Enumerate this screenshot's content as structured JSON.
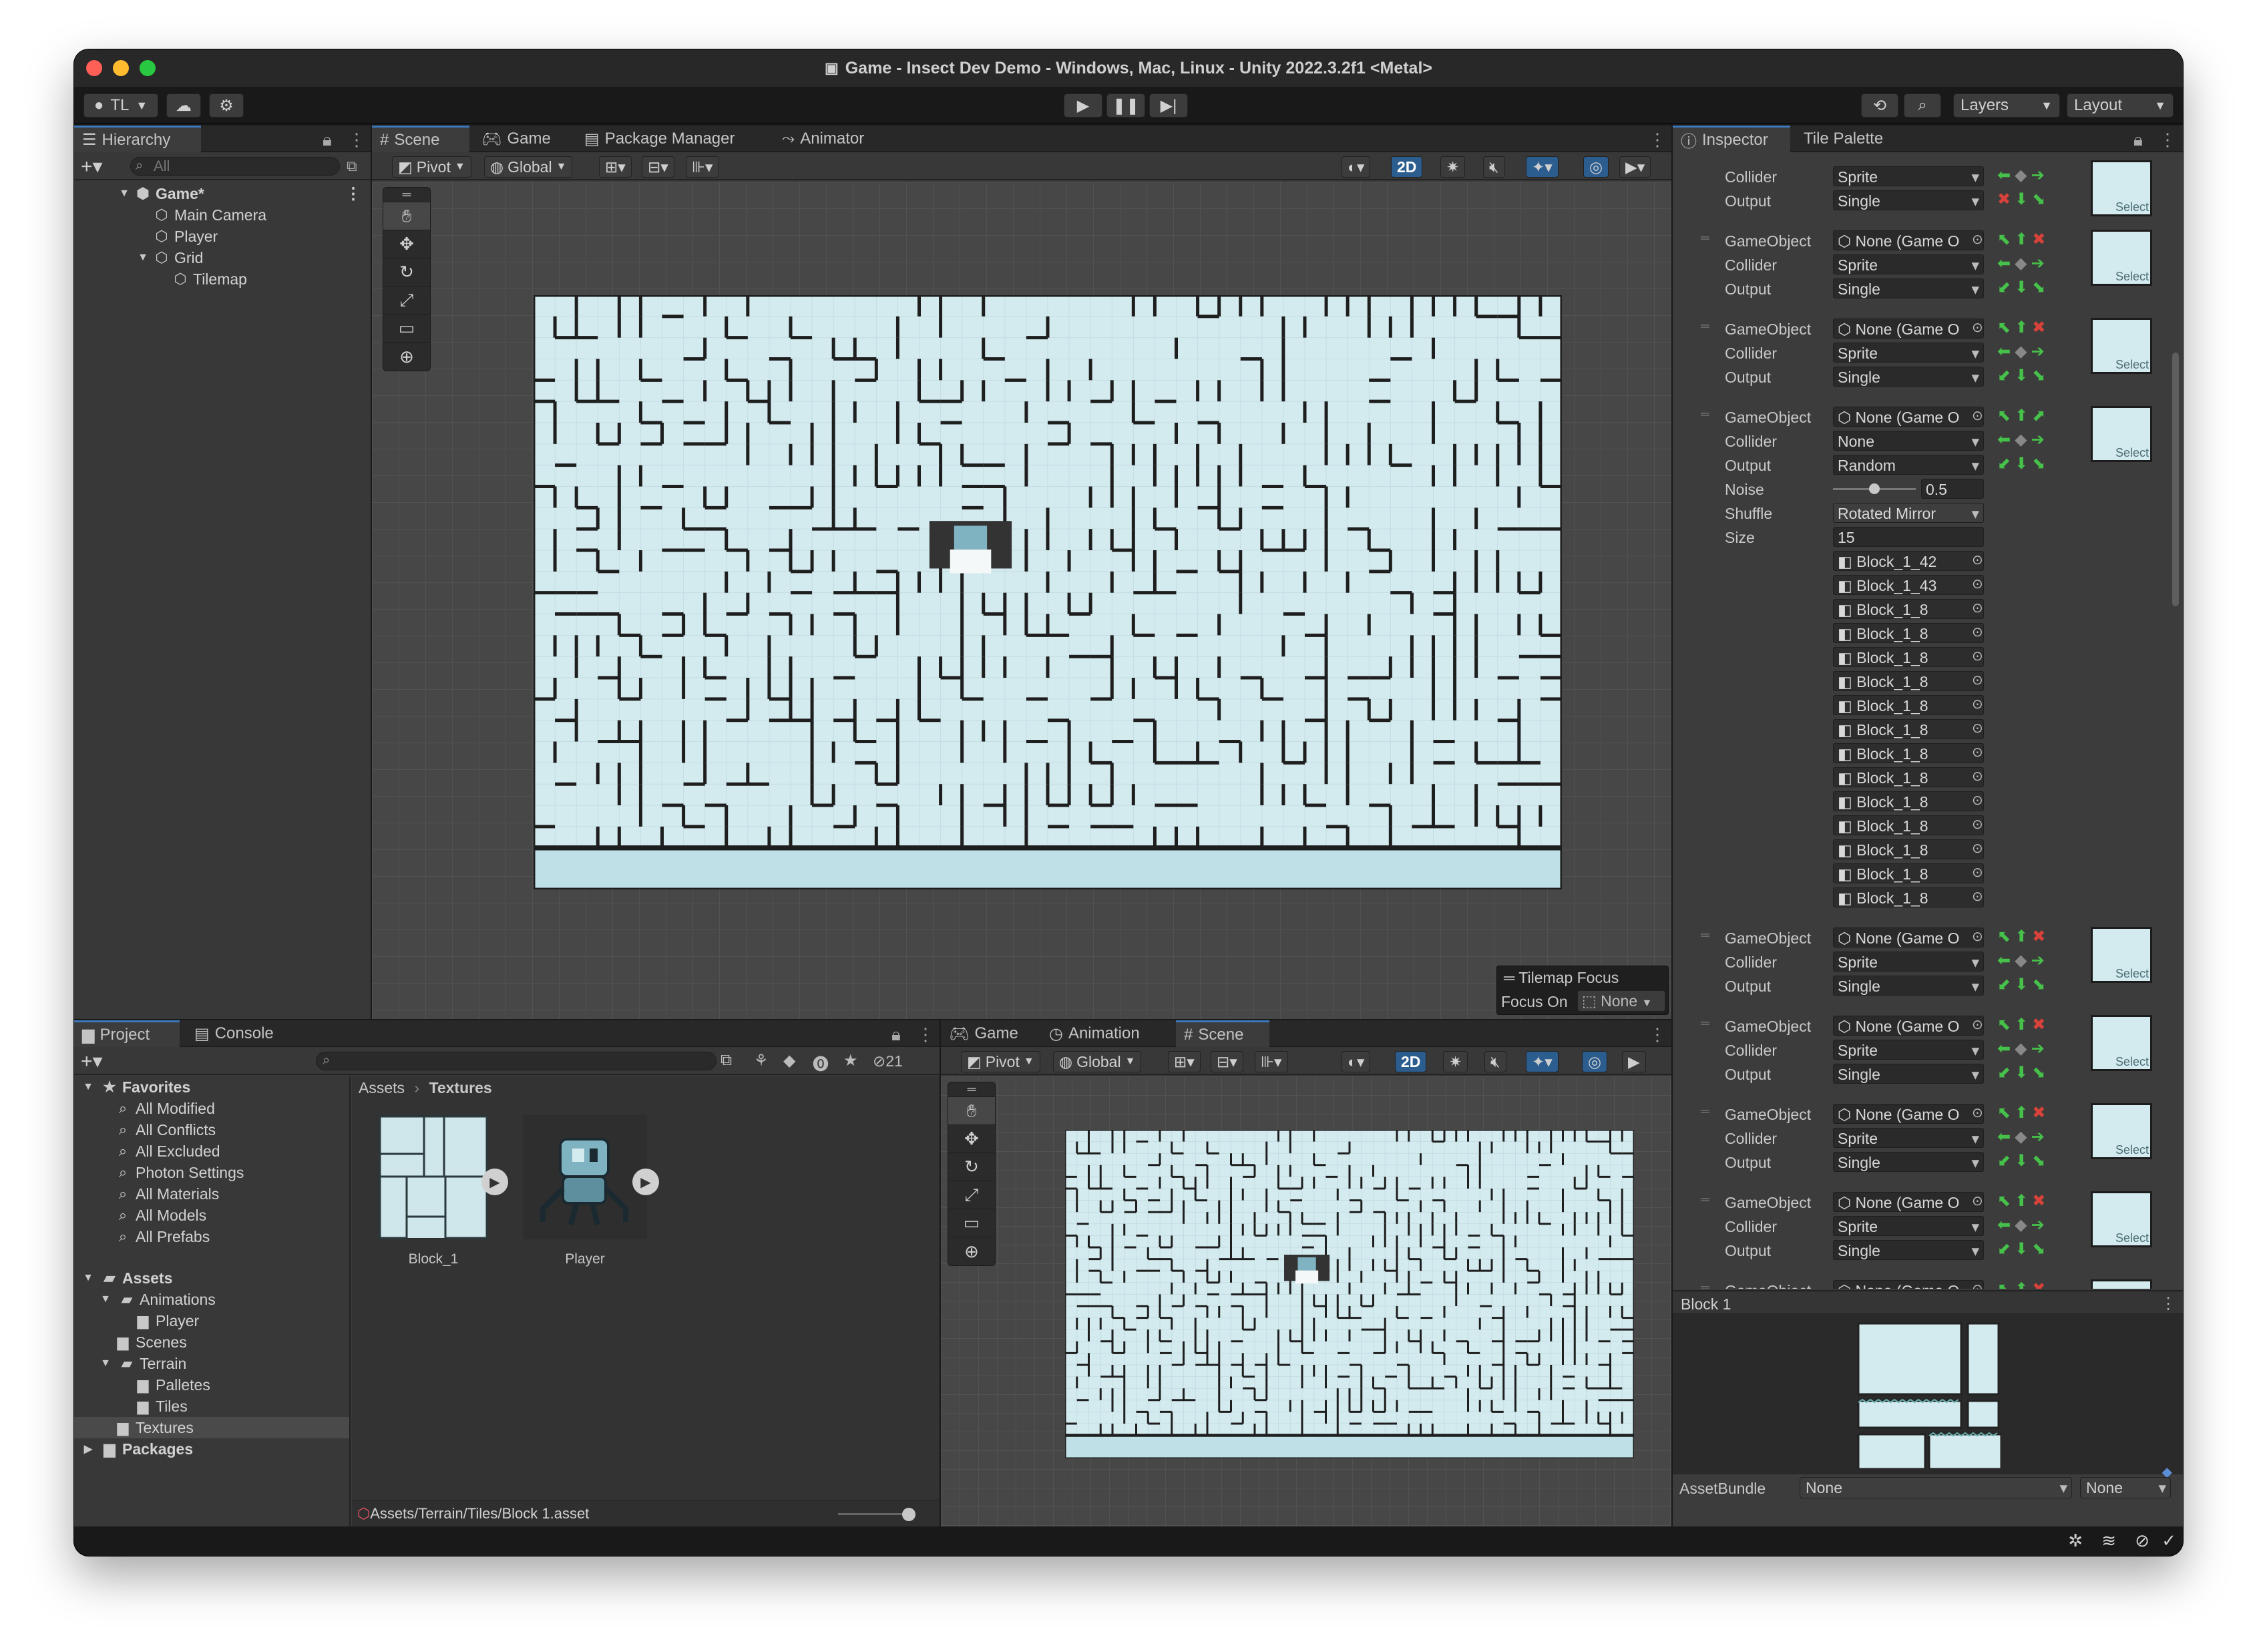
{
  "window": {
    "title": "Game - Insect Dev Demo - Windows, Mac, Linux - Unity 2022.3.2f1 <Metal>"
  },
  "colors": {
    "accent": "#3a79bb",
    "maze_bg": "#d3ebef",
    "wall": "#1e1e1e",
    "panel": "#383838",
    "green_arrow": "#46c24a",
    "red_x": "#d9423a"
  },
  "toolbar": {
    "account": "TL",
    "layers": "Layers",
    "layout": "Layout"
  },
  "hierarchy": {
    "tab": "Hierarchy",
    "search_placeholder": "All",
    "items": [
      {
        "label": "Game*",
        "icon": "unity-scene-icon"
      },
      {
        "label": "Main Camera",
        "icon": "gameobject-cube-icon"
      },
      {
        "label": "Player",
        "icon": "gameobject-cube-icon"
      },
      {
        "label": "Grid",
        "icon": "gameobject-cube-icon"
      },
      {
        "label": "Tilemap",
        "icon": "gameobject-cube-icon"
      }
    ]
  },
  "scene_view": {
    "tabs": [
      {
        "label": "Scene",
        "icon": "hash-icon"
      },
      {
        "label": "Game",
        "icon": "gamepad-icon"
      },
      {
        "label": "Package Manager",
        "icon": "package-icon"
      },
      {
        "label": "Animator",
        "icon": "animator-icon"
      }
    ],
    "pivot": "Pivot",
    "global": "Global",
    "mode_2d": "2D",
    "tilemap_focus_title": "Tilemap Focus",
    "focus_on_label": "Focus On",
    "focus_on_value": "None"
  },
  "project": {
    "tabs": [
      {
        "label": "Project",
        "icon": "folder-icon"
      },
      {
        "label": "Console",
        "icon": "console-icon"
      }
    ],
    "hidden_count": "21",
    "favorites_label": "Favorites",
    "favorites": [
      "All Modified",
      "All Conflicts",
      "All Excluded",
      "Photon Settings",
      "All Materials",
      "All Models",
      "All Prefabs"
    ],
    "assets_label": "Assets",
    "folders": [
      "Animations",
      "Player",
      "Scenes",
      "Terrain",
      "Palletes",
      "Tiles",
      "Textures"
    ],
    "packages_label": "Packages",
    "breadcrumb_root": "Assets",
    "breadcrumb_current": "Textures",
    "files": [
      {
        "name": "Block_1"
      },
      {
        "name": "Player"
      }
    ],
    "selected_path": "Assets/Terrain/Tiles/Block 1.asset"
  },
  "game_view": {
    "tabs": [
      {
        "label": "Game",
        "icon": "gamepad-icon"
      },
      {
        "label": "Animation",
        "icon": "clock-icon"
      },
      {
        "label": "Scene",
        "icon": "hash-icon"
      }
    ],
    "pivot": "Pivot",
    "global": "Global",
    "mode_2d": "2D"
  },
  "inspector": {
    "tabs": [
      {
        "label": "Inspector",
        "icon": "info-icon"
      },
      {
        "label": "Tile Palette",
        "icon": ""
      }
    ],
    "labels": {
      "gameobject": "GameObject",
      "collider": "Collider",
      "output": "Output",
      "noise": "Noise",
      "shuffle": "Shuffle",
      "size": "Size",
      "select": "Select"
    },
    "none_game": "None (Game O",
    "first_rule": {
      "collider": "Sprite",
      "output": "Single"
    },
    "rules": [
      {
        "collider": "Sprite",
        "output": "Single"
      },
      {
        "collider": "Sprite",
        "output": "Single"
      },
      {
        "collider": "None",
        "output": "Random",
        "noise": "0.5",
        "noise_fraction": 0.5,
        "shuffle": "Rotated Mirror",
        "size": "15"
      },
      {
        "collider": "Sprite",
        "output": "Single"
      },
      {
        "collider": "Sprite",
        "output": "Single"
      },
      {
        "collider": "Sprite",
        "output": "Single"
      },
      {
        "collider": "Sprite",
        "output": "Single"
      }
    ],
    "sprites": [
      "Block_1_42",
      "Block_1_43",
      "Block_1_8",
      "Block_1_8",
      "Block_1_8",
      "Block_1_8",
      "Block_1_8",
      "Block_1_8",
      "Block_1_8",
      "Block_1_8",
      "Block_1_8",
      "Block_1_8",
      "Block_1_8",
      "Block_1_8",
      "Block_1_8"
    ],
    "preview_title": "Block 1",
    "assetbundle_label": "AssetBundle",
    "assetbundle_value": "None",
    "assetbundle_variant": "None"
  }
}
